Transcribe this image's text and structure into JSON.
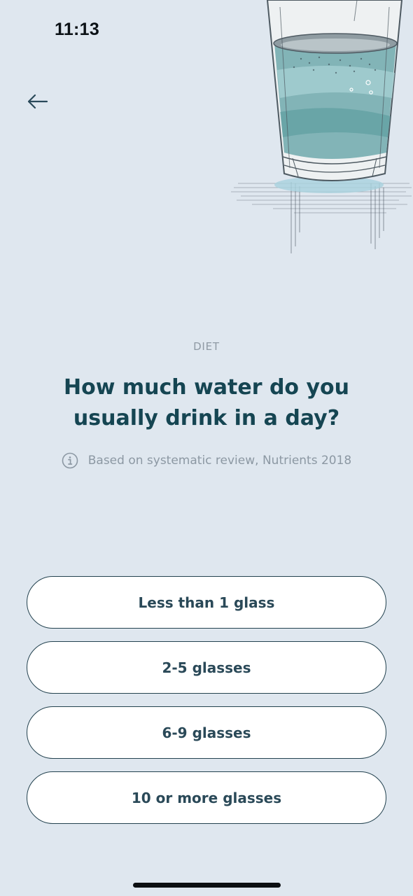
{
  "status_bar": {
    "time": "11:13"
  },
  "header": {
    "back_icon": "arrow-left-icon"
  },
  "question": {
    "category": "DIET",
    "title": "How much water do you usually drink in a day?",
    "source_icon": "info-icon",
    "source": "Based on systematic review, Nutrients 2018"
  },
  "options": [
    {
      "label": "Less than 1 glass"
    },
    {
      "label": "2-5 glasses"
    },
    {
      "label": "6-9 glasses"
    },
    {
      "label": "10 or more glasses"
    }
  ],
  "colors": {
    "background": "#dfe7ef",
    "title": "#154552",
    "option_border": "#23424f",
    "option_fill": "#ffffff",
    "water": "#7fb8bf"
  }
}
